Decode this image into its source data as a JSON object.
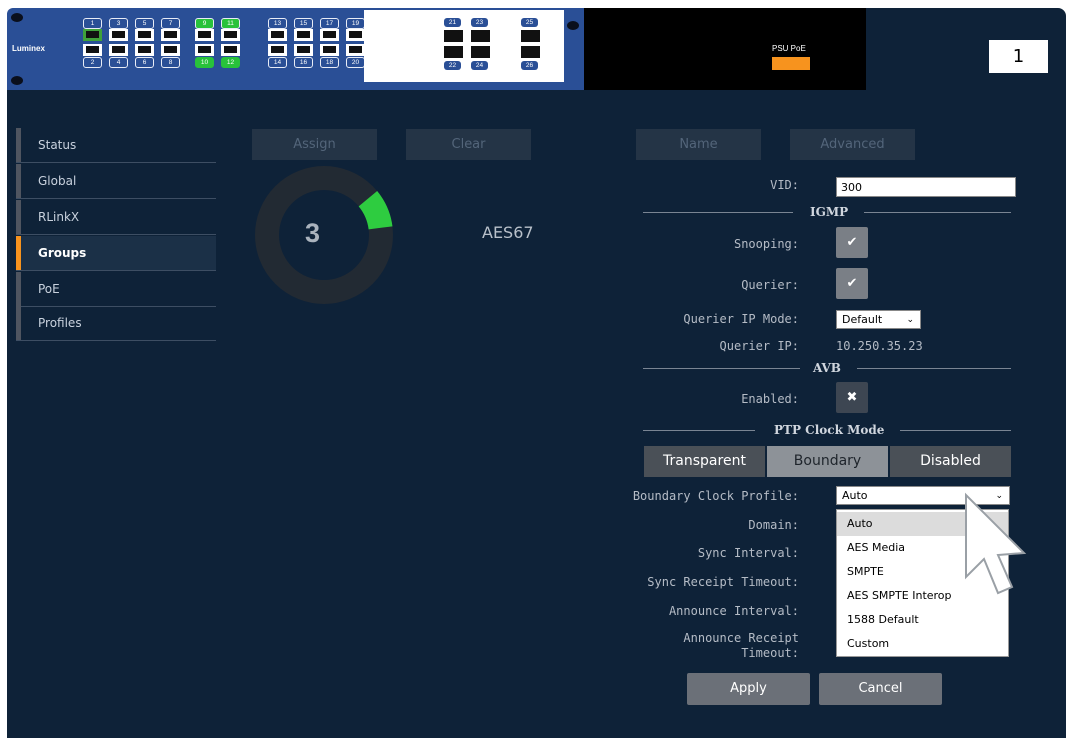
{
  "device": {
    "brand": "Luminex",
    "ports_top": [
      "1",
      "3",
      "5",
      "7",
      "9",
      "11",
      "13",
      "15",
      "17",
      "19",
      "21",
      "23"
    ],
    "ports_bottom": [
      "2",
      "4",
      "6",
      "8",
      "10",
      "12",
      "14",
      "16",
      "18",
      "20",
      "22",
      "24"
    ],
    "green_ports": [
      "9",
      "11",
      "10",
      "12"
    ],
    "sfp_top": [
      "21",
      "23",
      "25"
    ],
    "sfp_bottom": [
      "22",
      "24",
      "26"
    ],
    "psu_label": "PSU PoE",
    "unit_number": "1"
  },
  "sidebar": {
    "items": [
      {
        "label": "Status"
      },
      {
        "label": "Global"
      },
      {
        "label": "RLinkX"
      },
      {
        "label": "Groups"
      },
      {
        "label": "PoE"
      },
      {
        "label": "Profiles"
      }
    ],
    "active": "Groups"
  },
  "toolbar": {
    "assign": "Assign",
    "clear": "Clear",
    "name": "Name",
    "advanced": "Advanced"
  },
  "group": {
    "number": "3",
    "name": "AES67",
    "ring_fill_fraction": 0.09,
    "ring_color": "#2ecc40"
  },
  "form": {
    "vid_label": "VID:",
    "vid_value": "300",
    "igmp_title": "IGMP",
    "snooping_label": "Snooping:",
    "querier_label": "Querier:",
    "querier_ip_mode_label": "Querier IP Mode:",
    "querier_ip_mode_value": "Default",
    "querier_ip_label": "Querier IP:",
    "querier_ip_value": "10.250.35.23",
    "avb_title": "AVB",
    "enabled_label": "Enabled:",
    "ptp_title": "PTP Clock Mode",
    "ptp_modes": [
      "Transparent",
      "Boundary",
      "Disabled"
    ],
    "ptp_selected": "Boundary",
    "boundary_profile_label": "Boundary Clock Profile:",
    "boundary_profile_value": "Auto",
    "domain_label": "Domain:",
    "sync_interval_label": "Sync Interval:",
    "sync_receipt_label": "Sync Receipt Timeout:",
    "announce_interval_label": "Announce Interval:",
    "announce_receipt_label_1": "Announce Receipt",
    "announce_receipt_label_2": "Timeout:"
  },
  "dropdown": {
    "options": [
      "Auto",
      "AES Media",
      "SMPTE",
      "AES SMPTE Interop",
      "1588 Default",
      "Custom"
    ],
    "highlighted": "Auto"
  },
  "actions": {
    "apply": "Apply",
    "cancel": "Cancel"
  },
  "icons": {
    "check": "check-icon",
    "cross": "close-icon",
    "chevron": "chevron-down-icon"
  }
}
